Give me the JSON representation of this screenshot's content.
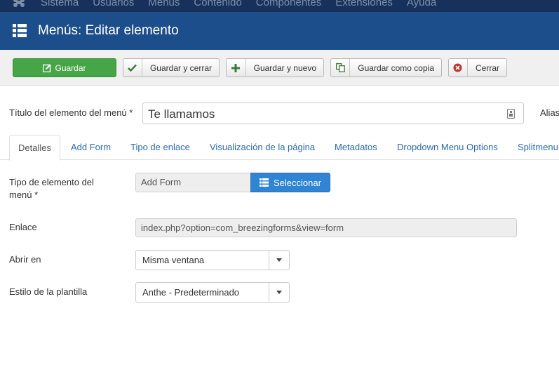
{
  "top_menu": {
    "items": [
      "Sistema",
      "Usuarios",
      "Menús",
      "Contenido",
      "Componentes",
      "Extensiones",
      "Ayuda"
    ]
  },
  "header": {
    "icon": "list-icon",
    "title": "Menús: Editar elemento"
  },
  "toolbar": {
    "save_label": "Guardar",
    "save_close_label": "Guardar y cerrar",
    "save_new_label": "Guardar y nuevo",
    "save_copy_label": "Guardar como copia",
    "close_label": "Cerrar"
  },
  "title_field": {
    "label": "Título del elemento del menú *",
    "value": "Te llamamos",
    "alias_label": "Alias"
  },
  "tabs": [
    "Detalles",
    "Add Form",
    "Tipo de enlace",
    "Visualización de la página",
    "Metadatos",
    "Dropdown Menu Options",
    "Splitmenu"
  ],
  "form": {
    "type": {
      "label_line1": "Tipo de elemento del",
      "label_line2": "menú *",
      "value": "Add Form",
      "button_label": "Seleccionar"
    },
    "link": {
      "label": "Enlace",
      "value": "index.php?option=com_breezingforms&view=form"
    },
    "open_in": {
      "label": "Abrir en",
      "value": "Misma ventana"
    },
    "template_style": {
      "label": "Estilo de la plantilla",
      "value": "Anthe - Predeterminado"
    }
  },
  "colors": {
    "top_nav": "#16325c",
    "header": "#1d4e8c",
    "save_button": "#46a546",
    "select_button": "#2f84d3",
    "link_text": "#2a69b8"
  }
}
